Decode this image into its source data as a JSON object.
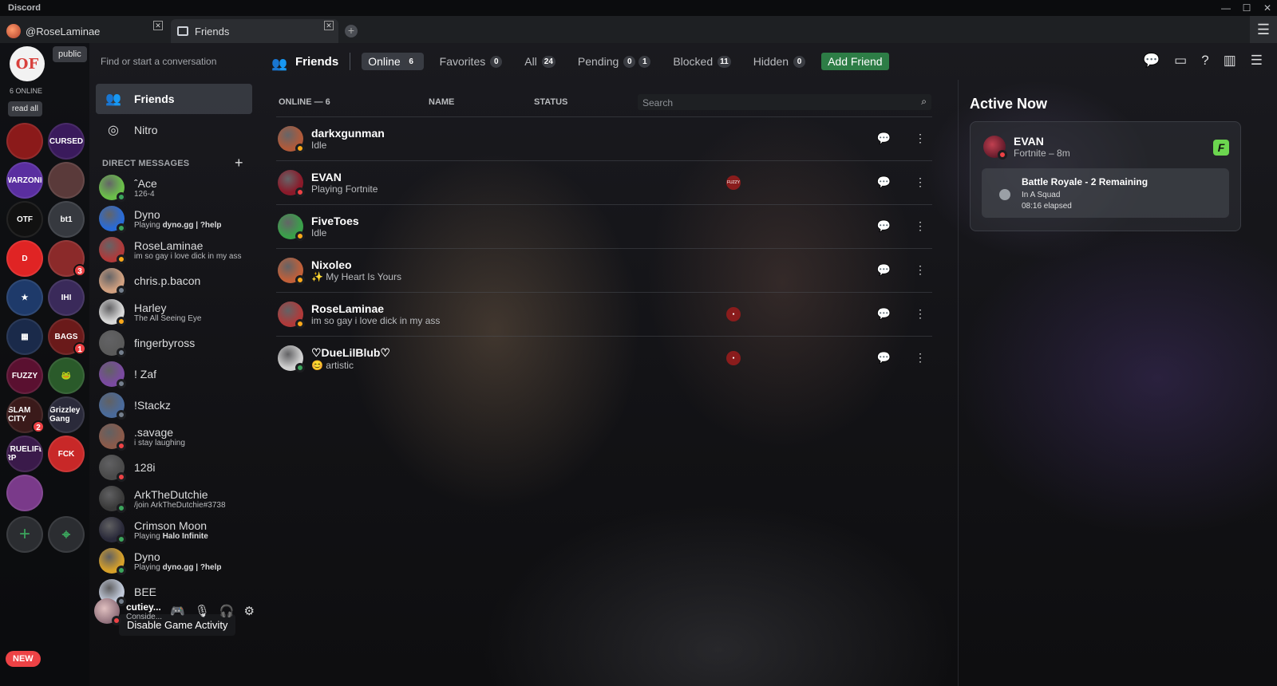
{
  "window": {
    "app_name": "Discord",
    "controls": [
      "—",
      "☐",
      "✕"
    ]
  },
  "tabs": [
    {
      "label": "@RoseLaminae",
      "close": "✕"
    },
    {
      "label": "Friends",
      "close": "✕"
    }
  ],
  "tab_add": "+",
  "server_rail": {
    "me_logo_text": "OF",
    "public_tag": "public",
    "online_count": "6 ONLINE",
    "read_all": "read all",
    "servers": [
      {
        "label": "",
        "color": "#8b1a1a"
      },
      {
        "label": "CURSED",
        "color": "#3a1a5c"
      },
      {
        "label": "WARZONE",
        "color": "#5a2ea0"
      },
      {
        "label": "",
        "color": "#5a3a3a"
      },
      {
        "label": "OTF",
        "color": "#111111"
      },
      {
        "label": "bt1",
        "color": "#36393f"
      },
      {
        "label": "D",
        "color": "#e02424"
      },
      {
        "label": "",
        "color": "#8b2a2a",
        "badge": "3"
      },
      {
        "label": "★",
        "color": "#1e3a6a"
      },
      {
        "label": "IHI",
        "color": "#3a2a5a"
      },
      {
        "label": "▦",
        "color": "#1a2a4a"
      },
      {
        "label": "BAGS",
        "color": "#6a1a1a",
        "badge": "1"
      },
      {
        "label": "FUZZY",
        "color": "#5a1030"
      },
      {
        "label": "🐸",
        "color": "#2a5a2a"
      },
      {
        "label": "SLAM CITY",
        "color": "#3a1a1a",
        "badge": "2"
      },
      {
        "label": "Grizzley Gang",
        "color": "#2a2a3a"
      },
      {
        "label": "TRUELIFE RP",
        "color": "#3a1a4a"
      },
      {
        "label": "FCK",
        "color": "#c82828"
      },
      {
        "label": "",
        "color": "#7a3a8a"
      }
    ],
    "add_server": "+",
    "explore": "⌖",
    "new_badge": "NEW"
  },
  "dm_column": {
    "search_placeholder": "Find or start a conversation",
    "nav": [
      {
        "label": "Friends",
        "icon": "friends-icon"
      },
      {
        "label": "Nitro",
        "icon": "nitro-icon"
      }
    ],
    "direct_messages_header": "DIRECT MESSAGES",
    "add_dm": "+",
    "dms": [
      {
        "name": "ˆAce",
        "sub": "126-4",
        "status": "online",
        "color": "#6bbf4a"
      },
      {
        "name": "Dyno",
        "sub_prefix": "Playing ",
        "sub_bold": "dyno.gg | ?help",
        "status": "online",
        "color": "#2a6bd6"
      },
      {
        "name": "RoseLaminae",
        "sub": "im so gay i love dick in my ass",
        "status": "idle",
        "color": "#b03a3a"
      },
      {
        "name": "chris.p.bacon",
        "sub": "",
        "status": "offline",
        "color": "#d0a080"
      },
      {
        "name": "Harley",
        "sub": "The All Seeing Eye",
        "status": "idle",
        "color": "#d8d8d8"
      },
      {
        "name": "fingerbyross",
        "sub": "",
        "status": "offline",
        "color": "#5a5a5a"
      },
      {
        "name": "! Zaf",
        "sub": "",
        "status": "offline",
        "color": "#7a4aa0"
      },
      {
        "name": "!Stackz",
        "sub": "",
        "status": "offline",
        "color": "#4a6a9a"
      },
      {
        "name": ".savage",
        "sub": "i stay laughing",
        "status": "dnd",
        "color": "#8a5a4a"
      },
      {
        "name": "128i",
        "sub": "",
        "status": "dnd",
        "color": "#4a4a4a"
      },
      {
        "name": "ArkTheDutchie",
        "sub": "/join ArkTheDutchie#3738",
        "status": "online",
        "color": "#3a3a3a"
      },
      {
        "name": "Crimson Moon",
        "sub_prefix": "Playing ",
        "sub_bold": "Halo Infinite",
        "status": "online",
        "color": "#2a2a3a"
      },
      {
        "name": "Dyno",
        "sub_prefix": "Playing ",
        "sub_bold": "dyno.gg | ?help",
        "status": "online",
        "color": "#d6a02a"
      },
      {
        "name": "BEE",
        "sub": "",
        "status": "offline",
        "color": "#c0c8d8"
      }
    ],
    "tooltip": "Disable Game Activity",
    "user_panel": {
      "name": "cutiey...",
      "status": "Conside..."
    }
  },
  "topbar": {
    "title": "Friends",
    "tabs": [
      {
        "label": "Online",
        "count": "6",
        "active": true
      },
      {
        "label": "Favorites",
        "count": "0"
      },
      {
        "label": "All",
        "count": "24"
      },
      {
        "label": "Pending",
        "count": "0",
        "count2": "1"
      },
      {
        "label": "Blocked",
        "count": "11"
      },
      {
        "label": "Hidden",
        "count": "0"
      }
    ],
    "add_friend": "Add Friend"
  },
  "friend_list": {
    "header_online": "ONLINE — 6",
    "header_name": "NAME",
    "header_status": "STATUS",
    "search_placeholder": "Search",
    "friends": [
      {
        "name": "darkxgunman",
        "sub": "Idle",
        "status": "idle",
        "color": "#b05a3a"
      },
      {
        "name": "EVAN",
        "sub": "Playing Fortnite",
        "status": "dnd",
        "color": "#8a1a2a",
        "server_tag": "FUZZY"
      },
      {
        "name": "FiveToes",
        "sub": "Idle",
        "status": "idle",
        "color": "#3aa04a"
      },
      {
        "name": "Nixoleo",
        "sub": "✨ My Heart Is Yours",
        "status": "idle",
        "color": "#c0603a"
      },
      {
        "name": "RoseLaminae",
        "sub": "im so gay i love dick in my ass",
        "status": "idle",
        "color": "#b03a3a",
        "server_tag": "●"
      },
      {
        "name": "♡DueLilBlub♡",
        "sub": "😊 artistic",
        "status": "online",
        "color": "#d0d0d0",
        "server_tag": "●"
      }
    ]
  },
  "active_now": {
    "title": "Active Now",
    "user": "EVAN",
    "game": "Fortnite – 8m",
    "game_icon": "F",
    "activity_title": "Battle Royale - 2 Remaining",
    "activity_line1": "In A Squad",
    "activity_line2": "08:16 elapsed"
  }
}
